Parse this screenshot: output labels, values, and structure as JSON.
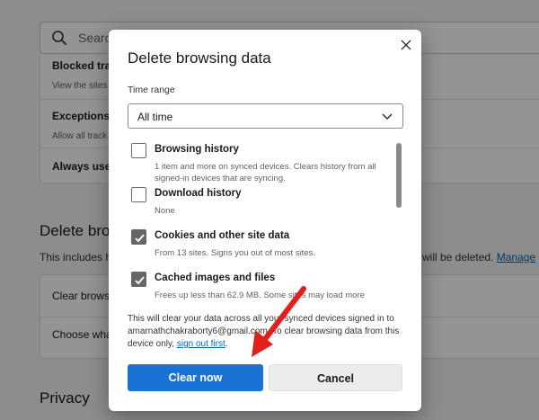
{
  "background": {
    "search": {
      "placeholder_text": "Searc"
    },
    "tracking_card": {
      "rows": [
        {
          "title": "Blocked trac",
          "desc": "View the sites"
        },
        {
          "title": "Exceptions",
          "desc": "Allow all track"
        },
        {
          "title": "Always use"
        }
      ]
    },
    "delete_section": {
      "title": "Delete bro",
      "desc_left": "This includes h",
      "desc_right": "will be deleted.",
      "manage_link": "Manage"
    },
    "delete_card": {
      "rows": [
        {
          "title": "Clear brows"
        },
        {
          "title": "Choose wha"
        }
      ]
    },
    "privacy_title": "Privacy"
  },
  "dialog": {
    "title": "Delete browsing data",
    "time_range_label": "Time range",
    "time_range_value": "All time",
    "options": [
      {
        "label": "Browsing history",
        "desc": "1 item and more on synced devices. Clears history from all signed-in devices that are syncing.",
        "checked": false
      },
      {
        "label": "Download history",
        "desc": "None",
        "checked": false
      },
      {
        "label": "Cookies and other site data",
        "desc": "From 13 sites. Signs you out of most sites.",
        "checked": true
      },
      {
        "label": "Cached images and files",
        "desc": "Frees up less than 62.9 MB. Some sites may load more",
        "checked": true
      }
    ],
    "notice": {
      "text_before": "This will clear your data across all your synced devices signed in to amarnathchakraborty6@gmail.com. To clear browsing data from this device only, ",
      "link": "sign out first",
      "text_after": "."
    },
    "clear_button": "Clear now",
    "cancel_button": "Cancel"
  },
  "colors": {
    "primary_button": "#1a73d4",
    "link": "#0066b4",
    "annotation_arrow": "#e0201b"
  },
  "icons": [
    "search-icon",
    "close-icon",
    "chevron-down-icon",
    "checkmark-icon"
  ]
}
